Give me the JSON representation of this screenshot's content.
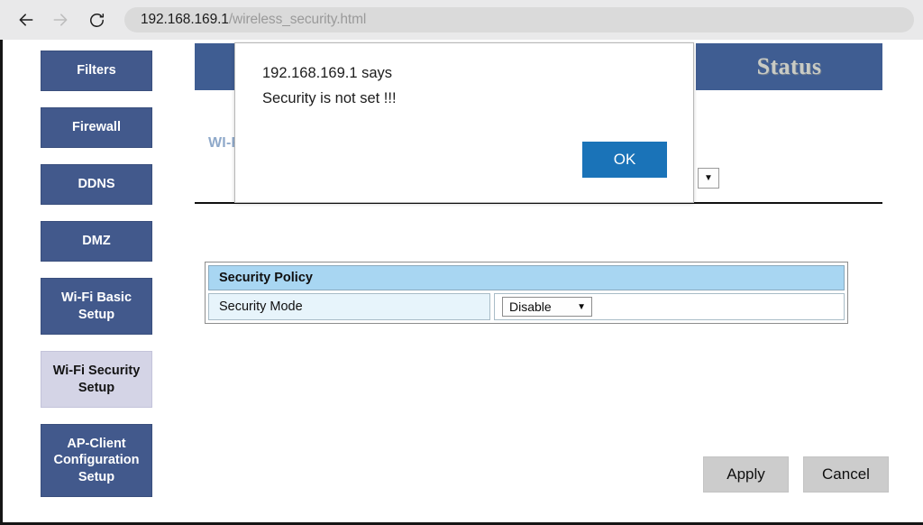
{
  "browser": {
    "back_icon": "arrow-left-icon",
    "forward_icon": "arrow-right-icon",
    "reload_icon": "reload-icon",
    "url_host": "192.168.169.1",
    "url_path": "/wireless_security.html",
    "url_full": "192.168.169.1/wireless_security.html"
  },
  "sidebar": {
    "items": [
      {
        "label": "Filters",
        "active": false
      },
      {
        "label": "Firewall",
        "active": false
      },
      {
        "label": "DDNS",
        "active": false
      },
      {
        "label": "DMZ",
        "active": false
      },
      {
        "label": "Wi-Fi Basic Setup",
        "active": false
      },
      {
        "label": "Wi-Fi Security Setup",
        "active": true
      },
      {
        "label": "AP-Client Configuration Setup",
        "active": false
      }
    ]
  },
  "header": {
    "status_label": "Status",
    "section_label": "WI-F"
  },
  "content": {
    "policy_title": "Security Policy",
    "security_mode_label": "Security Mode",
    "security_mode_value": "Disable",
    "caret_glyph": "▼"
  },
  "footer": {
    "apply_label": "Apply",
    "cancel_label": "Cancel"
  },
  "dialog": {
    "origin_line": "192.168.169.1 says",
    "message_line": "Security is not set !!!",
    "ok_label": "OK"
  },
  "colors": {
    "sidebar_blue": "#42598c",
    "sidebar_active": "#d4d4e6",
    "header_blue": "#3f5d92",
    "policy_header_blue": "#a8d6f2",
    "policy_row_blue": "#e7f4fb",
    "dialog_ok_blue": "#1a73b8",
    "grey_button": "#cccccc",
    "wifi_label_blue": "#8fa9ca",
    "status_text": "#c9cbc4"
  }
}
